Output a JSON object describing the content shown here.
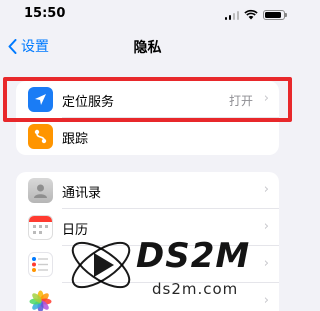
{
  "status_bar": {
    "time": "15:50"
  },
  "nav": {
    "back_label": "设置",
    "title": "隐私"
  },
  "groups": [
    {
      "items": [
        {
          "label": "定位服务",
          "value": "打开",
          "icon": "location-arrow-icon",
          "icon_color": "#1a7cf5"
        },
        {
          "label": "跟踪",
          "icon": "tracking-icon",
          "icon_color": "#ff9500"
        }
      ]
    },
    {
      "items": [
        {
          "label": "通讯录",
          "icon": "contacts-icon"
        },
        {
          "label": "日历",
          "icon": "calendar-icon"
        },
        {
          "label": "提醒事项",
          "icon": "reminders-icon"
        },
        {
          "label": "照片",
          "icon": "photos-icon"
        }
      ]
    }
  ],
  "highlight_color": "#e8282b",
  "watermark": {
    "logo_text": "DS2M",
    "url": "ds2m.com"
  }
}
